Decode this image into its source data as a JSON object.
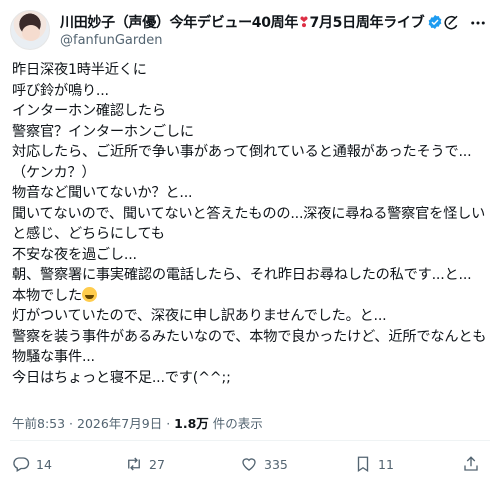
{
  "author": {
    "name": "川田妙子（声優）今年デビュー40周年",
    "name_suffix": "7月5日周年ライブ",
    "handle": "@fanfunGarden",
    "verified": true
  },
  "tweet_lines": [
    "昨日深夜1時半近くに",
    "呼び鈴が鳴り...",
    "インターホン確認したら",
    "警察官？インターホンごしに",
    "対応したら、ご近所で争い事があって倒れていると通報があったそうで...",
    "（ケンカ？）",
    "物音など聞いてないか？と...",
    "聞いてないので、聞いてないと答えたものの...深夜に尋ねる警察官を怪しいと感じ、どちらにしても",
    "不安な夜を過ごし...",
    "朝、警察署に事実確認の電話したら、それ昨日お尋ねしたの私です...と...",
    "本物でした",
    "灯がついていたので、深夜に申し訳ありませんでした。と...",
    "警察を装う事件があるみたいなので、本物で良かったけど、近所でなんとも物騒な事件...",
    "今日はちょっと寝不足...です(^^;;"
  ],
  "meta": {
    "time": "午前8:53",
    "date": "2026年7月9日",
    "views": "1.8万",
    "views_suffix": "件の表示"
  },
  "actions": {
    "replies": "14",
    "reposts": "27",
    "likes": "335",
    "bookmarks": "11"
  },
  "colors": {
    "text": "#0f1419",
    "muted": "#536471",
    "verified": "#1d9bf0",
    "heart": "#dd2e44"
  },
  "icons": [
    "grok-icon",
    "more-icon",
    "reply-icon",
    "repost-icon",
    "like-icon",
    "bookmark-icon",
    "share-icon",
    "verified-badge-icon",
    "heart-emoji",
    "grin-emoji"
  ]
}
